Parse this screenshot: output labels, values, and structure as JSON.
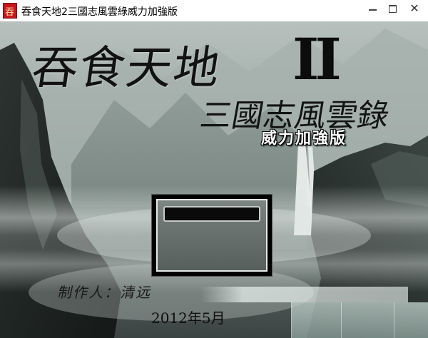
{
  "window": {
    "title": "吞食天地2三國志風雲綠威力加強版",
    "minimize_label": "",
    "maximize_label": "",
    "close_label": "✕"
  },
  "banner": {
    "main_title": "吞食天地",
    "numeral": "II",
    "subtitle": "三國志風雲錄",
    "edition": "威力加強版"
  },
  "credits": {
    "author": "制作人：清远",
    "date": "2012年5月"
  },
  "dialog": {
    "input_value": ""
  },
  "icons": [
    "app-logo-icon",
    "minimize-icon",
    "maximize-icon",
    "close-icon"
  ]
}
